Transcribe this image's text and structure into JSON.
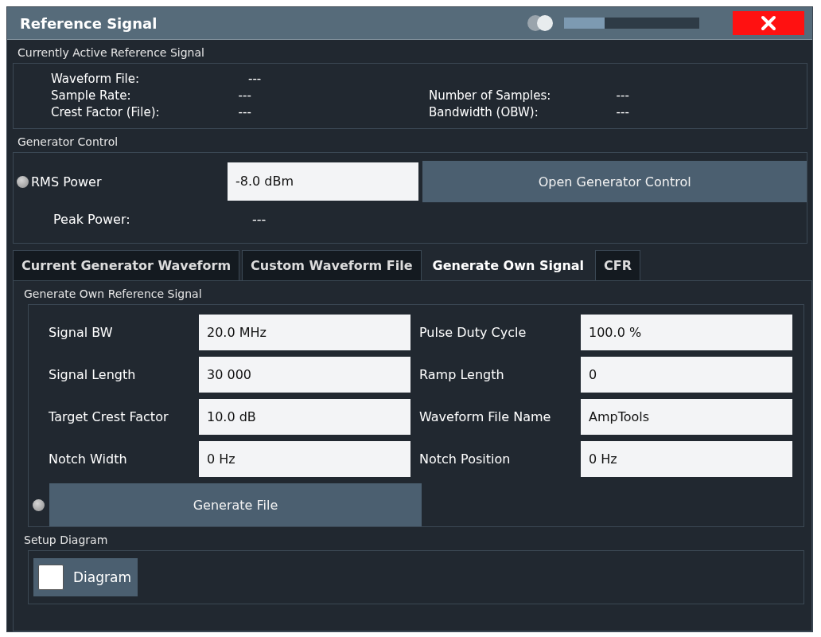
{
  "window": {
    "title": "Reference Signal",
    "transparency": {
      "level": 0.3
    }
  },
  "active_signal": {
    "title": "Currently Active Reference Signal",
    "rows": [
      {
        "label": "Waveform File:",
        "value": "---"
      },
      {
        "label": "Sample Rate:",
        "value": "---",
        "label_2": "Number of Samples:",
        "value_2": "---"
      },
      {
        "label": "Crest Factor (File):",
        "value": "---",
        "label_2": "Bandwidth (OBW):",
        "value_2": "---"
      }
    ]
  },
  "generator_control": {
    "title": "Generator Control",
    "rms_power": {
      "label": "RMS Power",
      "value": "-8.0 dBm"
    },
    "open_button": "Open Generator Control",
    "peak_power": {
      "label": "Peak Power:",
      "value": "---"
    }
  },
  "tabs": [
    {
      "label": "Current Generator Waveform",
      "selected": false
    },
    {
      "label": "Custom Waveform File",
      "selected": false
    },
    {
      "label": "Generate Own Signal",
      "selected": true
    },
    {
      "label": "CFR",
      "selected": false
    }
  ],
  "own_signal": {
    "title": "Generate Own Reference Signal",
    "fields": [
      {
        "label": "Signal BW",
        "value": "20.0 MHz"
      },
      {
        "label": "Pulse Duty Cycle",
        "value": "100.0 %"
      },
      {
        "label": "Signal Length",
        "value": "30 000"
      },
      {
        "label": "Ramp Length",
        "value": "0"
      },
      {
        "label": "Target Crest Factor",
        "value": "10.0 dB"
      },
      {
        "label": "Waveform File Name",
        "value": "AmpTools"
      },
      {
        "label": "Notch Width",
        "value": "0 Hz"
      },
      {
        "label": "Notch Position",
        "value": "0 Hz"
      }
    ],
    "generate_button": "Generate File"
  },
  "setup_diagram": {
    "title": "Setup Diagram",
    "checkbox": {
      "label": "Diagram",
      "checked": false
    }
  }
}
